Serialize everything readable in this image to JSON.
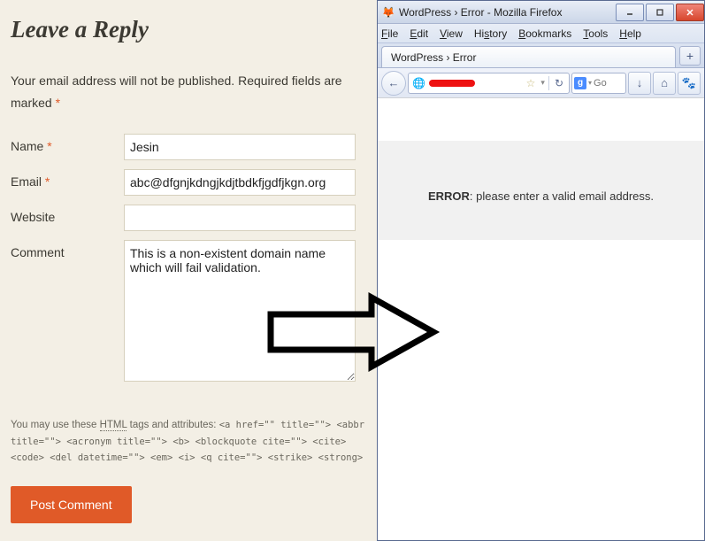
{
  "form": {
    "title": "Leave a Reply",
    "note": "Your email address will not be published. Required fields are marked ",
    "asterisk": "*",
    "labels": {
      "name": "Name ",
      "email": "Email ",
      "website": "Website",
      "comment": "Comment"
    },
    "values": {
      "name": "Jesin",
      "email": "abc@dfgnjkdngjkdjtbdkfjgdfjkgn.org",
      "website": "",
      "comment": "This is a non-existent domain name which will fail validation."
    },
    "tags_note": {
      "prefix": "You may use these ",
      "html": "HTML",
      "mid": " tags and attributes: ",
      "code": "<a href=\"\" title=\"\"> <abbr title=\"\"> <acronym title=\"\"> <b> <blockquote cite=\"\"> <cite> <code> <del datetime=\"\"> <em> <i> <q cite=\"\"> <strike> <strong>"
    },
    "submit": "Post Comment"
  },
  "browser": {
    "window_title": "WordPress › Error - Mozilla Firefox",
    "firefox_glyph": "🦊",
    "menus": {
      "file": "File",
      "edit": "Edit",
      "view": "View",
      "history": "History",
      "bookmarks": "Bookmarks",
      "tools": "Tools",
      "help": "Help"
    },
    "tab_title": "WordPress › Error",
    "newtab_glyph": "+",
    "back_glyph": "←",
    "reload_glyph": "↻",
    "search": {
      "g": "g",
      "placeholder": "Go",
      "dd": "▾"
    },
    "download_glyph": "↓",
    "home_glyph": "⌂",
    "dev_glyph": "🐾",
    "min_glyph": "–",
    "max_glyph": "□",
    "close_glyph": "×",
    "globe_glyph": "🌐",
    "star_glyph": "☆",
    "dd_glyph": "▾",
    "error": {
      "strong": "ERROR",
      "rest": ": please enter a valid email address."
    }
  }
}
